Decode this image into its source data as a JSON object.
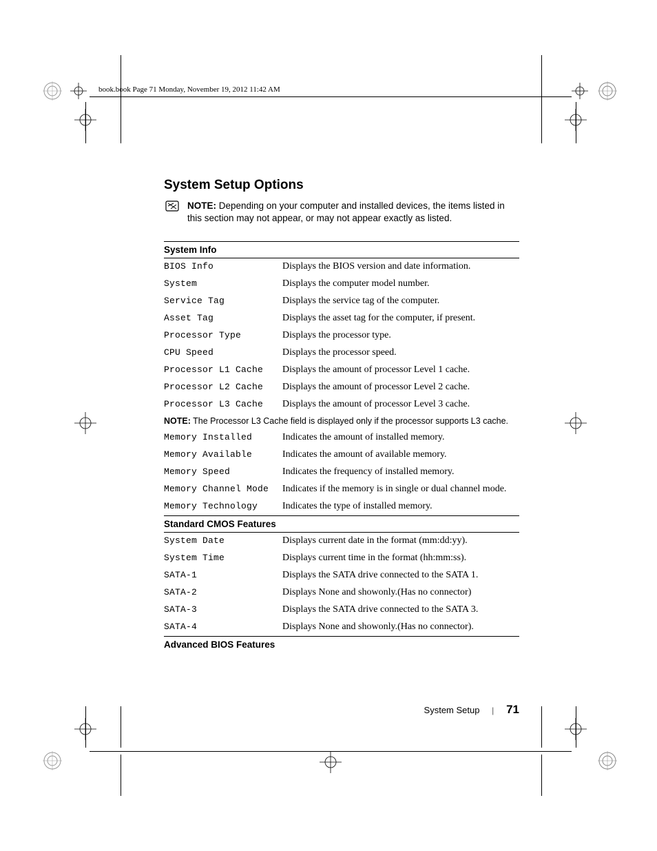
{
  "header": "book.book  Page 71  Monday, November 19, 2012  11:42 AM",
  "section_title": "System Setup Options",
  "note": {
    "label": "NOTE:",
    "text": " Depending on your computer and installed devices, the items listed in this section may not appear, or may not appear exactly as listed."
  },
  "sections": [
    {
      "header": "System Info",
      "rows": [
        {
          "label": "BIOS Info",
          "desc": "Displays the BIOS version and date information."
        },
        {
          "label": "System",
          "desc": "Displays the computer model number."
        },
        {
          "label": "Service Tag",
          "desc": "Displays the service tag of the computer."
        },
        {
          "label": "Asset Tag",
          "desc": "Displays the asset tag for the computer, if present."
        },
        {
          "label": "Processor Type",
          "desc": "Displays the processor type."
        },
        {
          "label": "CPU Speed",
          "desc": "Displays the processor speed."
        },
        {
          "label": "Processor L1 Cache",
          "desc": "Displays the amount of processor Level 1 cache."
        },
        {
          "label": "Processor L2 Cache",
          "desc": "Displays the amount of processor Level 2 cache."
        },
        {
          "label": "Processor L3 Cache",
          "desc": "Displays the amount of processor Level 3 cache."
        }
      ],
      "note_row": {
        "label": "NOTE:",
        "text": " The Processor L3 Cache field is displayed only if the processor supports L3 cache."
      },
      "rows2": [
        {
          "label": "Memory Installed",
          "desc": "Indicates the amount of installed memory."
        },
        {
          "label": "Memory Available",
          "desc": "Indicates the amount of available memory."
        },
        {
          "label": "Memory Speed",
          "desc": "Indicates the frequency of installed memory."
        },
        {
          "label": "Memory Channel Mode",
          "desc": "Indicates if the memory is in single or dual channel mode."
        },
        {
          "label": "Memory Technology",
          "desc": "Indicates the type of installed memory."
        }
      ]
    },
    {
      "header": "Standard CMOS Features",
      "rows": [
        {
          "label": "System Date",
          "desc": "Displays current date in the format (mm:dd:yy)."
        },
        {
          "label": "System Time",
          "desc": "Displays current time in the format (hh:mm:ss)."
        },
        {
          "label": "SATA-1",
          "desc": "Displays the SATA drive connected to the SATA 1."
        },
        {
          "label": "SATA-2",
          "desc": "Displays None and showonly.(Has no connector)"
        },
        {
          "label": "SATA-3",
          "desc": "Displays the SATA drive connected to the SATA 3."
        },
        {
          "label": "SATA-4",
          "desc": "Displays None and showonly.(Has no connector)."
        }
      ]
    },
    {
      "header": "Advanced BIOS Features",
      "rows": []
    }
  ],
  "footer": {
    "title": "System Setup",
    "page": "71"
  }
}
